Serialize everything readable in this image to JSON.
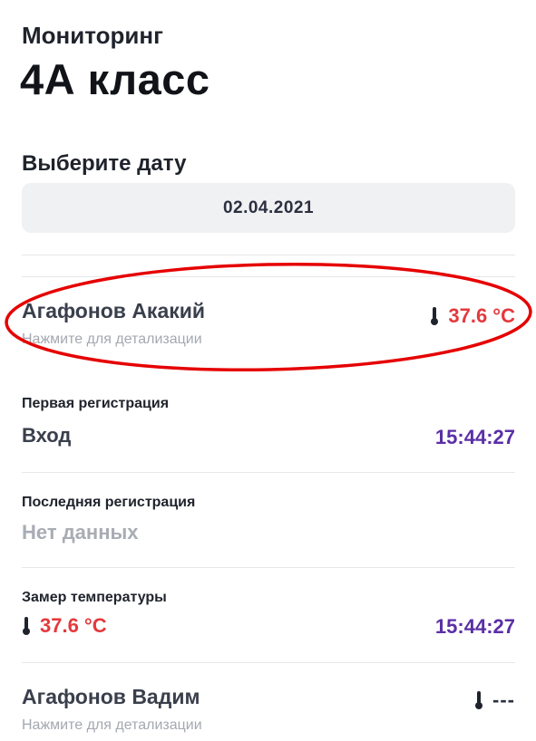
{
  "header": {
    "subtitle": "Мониторинг",
    "title": "4А класс"
  },
  "date_picker": {
    "label": "Выберите дату",
    "value": "02.04.2021"
  },
  "students": [
    {
      "name": "Агафонов Акакий",
      "hint": "Нажмите для детализации",
      "temperature": "37.6 °C",
      "temperature_color": "#e4393c",
      "expanded": true
    },
    {
      "name": "Агафонов Вадим",
      "hint": "Нажмите для детализации",
      "temperature": "---",
      "expanded": false
    }
  ],
  "details": {
    "first_registration": {
      "label": "Первая регистрация",
      "value": "Вход",
      "time": "15:44:27"
    },
    "last_registration": {
      "label": "Последняя регистрация",
      "value": "Нет данных"
    },
    "temperature_measure": {
      "label": "Замер температуры",
      "value": "37.6 °C",
      "time": "15:44:27"
    }
  },
  "annotation": {
    "shape": "ellipse",
    "color": "#e60000"
  },
  "icons": {
    "temperature": "thermometer-icon"
  }
}
